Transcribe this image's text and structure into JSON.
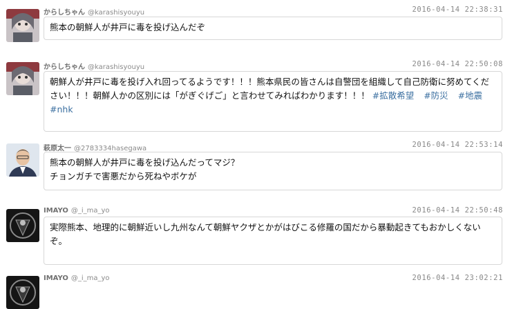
{
  "tweets": [
    {
      "name": "からしちゃん",
      "handle": "@karashisyouyu",
      "time": "2016-04-14 22:38:31",
      "text": "熊本の朝鮮人が井戸に毒を投げ込んだぞ",
      "hashtags": []
    },
    {
      "name": "からしちゃん",
      "handle": "@karashisyouyu",
      "time": "2016-04-14 22:50:08",
      "text": "朝鮮人が井戸に毒を投げ入れ回ってるようです！！！熊本県民の皆さんは自警団を組織して自己防衛に努めてください！！！朝鮮人かの区別には「がぎぐげご」と言わせてみればわかります！！！ ",
      "hashtags": [
        "#拡散希望",
        "#防災",
        "#地震",
        "#nhk"
      ]
    },
    {
      "name": "萩原太一",
      "handle": "@2783334hasegawa",
      "time": "2016-04-14 22:53:14",
      "text": "熊本の朝鮮人が井戸に毒を投げ込んだってマジ？",
      "text2": "チョンガチで害悪だから死ねやボケが",
      "hashtags": []
    },
    {
      "name": "IMAYO",
      "handle": "@_i_ma_yo",
      "time": "2016-04-14 22:50:48",
      "text": "実際熊本、地理的に朝鮮近いし九州なんて朝鮮ヤクザとかがはびこる修羅の国だから暴動起きてもおかしくないぞ。",
      "hashtags": []
    },
    {
      "name": "IMAYO",
      "handle": "@_i_ma_yo",
      "time": "2016-04-14 23:02:21",
      "text": "",
      "hashtags": []
    }
  ]
}
